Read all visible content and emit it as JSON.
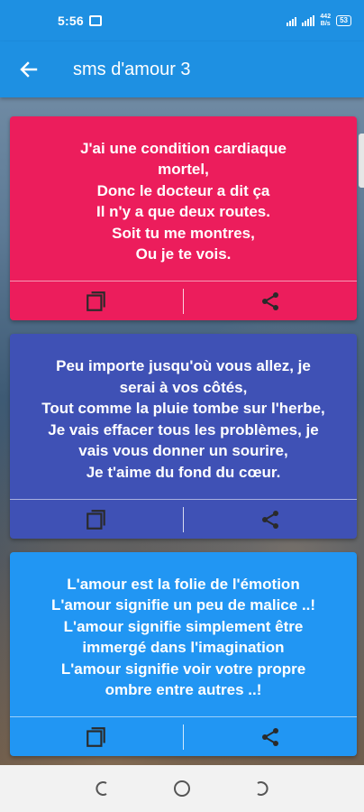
{
  "status": {
    "time": "5:56",
    "network_top": "442",
    "network_bottom": "B/s",
    "battery": "53"
  },
  "app_bar": {
    "title": "sms d'amour 3",
    "back_icon": "arrow-left-icon"
  },
  "cards": [
    {
      "color": "#ec1d5c",
      "text": "J'ai une condition cardiaque\nmortel,\nDonc le docteur a dit ça\nIl n'y a que deux routes.\nSoit tu me montres,\nOu je te vois."
    },
    {
      "color": "#3f51b5",
      "text": "Peu importe jusqu'où vous allez, je\nserai à vos côtés,\nTout comme la pluie tombe sur l'herbe,\nJe vais effacer tous les problèmes, je\nvais vous donner un sourire,\nJe t'aime du fond du cœur."
    },
    {
      "color": "#2196f3",
      "text": "L'amour est la folie de l'émotion\nL'amour signifie un peu de malice ..!\nL'amour signifie simplement être\nimmergé dans l'imagination\nL'amour signifie voir votre propre\nombre entre autres ..!"
    }
  ],
  "card_actions": {
    "copy_icon": "copy-icon",
    "share_icon": "share-icon"
  },
  "nav": {
    "recent_icon": "recent-apps-icon",
    "home_icon": "home-icon",
    "back_icon": "back-nav-icon"
  }
}
